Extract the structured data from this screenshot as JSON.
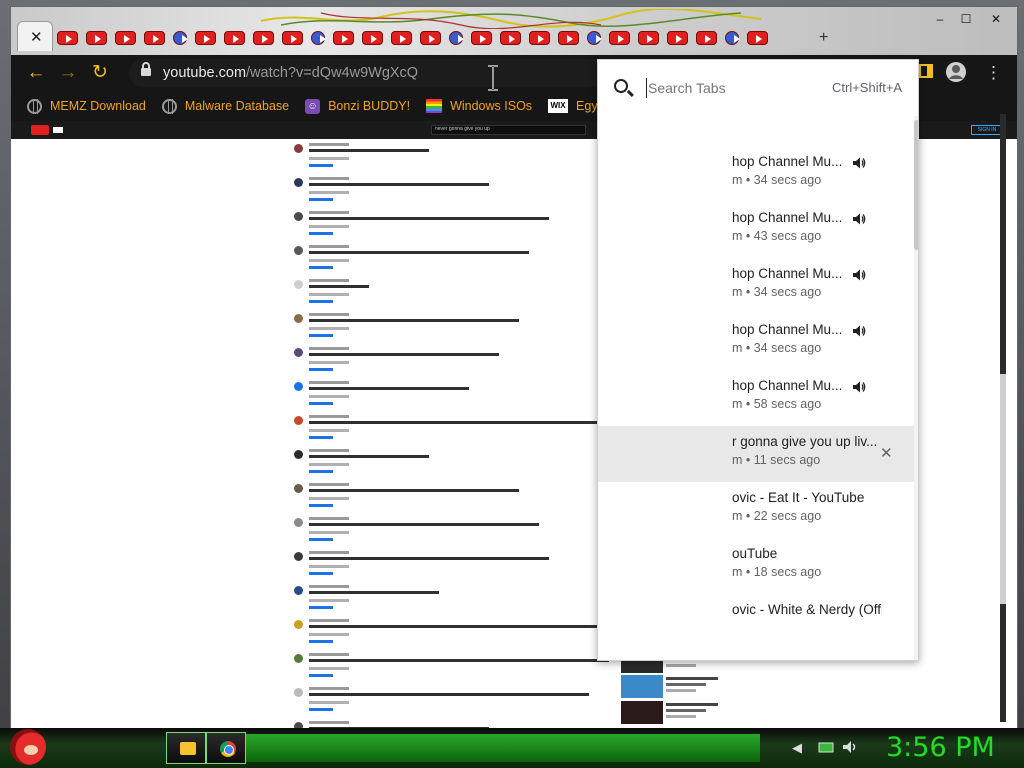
{
  "browser": {
    "url_host": "youtube.com",
    "url_path": "/watch?v=dQw4w9WgXcQ",
    "close_tab_glyph": "✕",
    "new_tab_glyph": "+",
    "window_minimize": "–",
    "window_maximize": "☐",
    "window_close": "✕"
  },
  "bookmarks": [
    {
      "label": "MEMZ Download",
      "icon": "globe-icon"
    },
    {
      "label": "Malware Database",
      "icon": "globe-icon"
    },
    {
      "label": "Bonzi BUDDY!",
      "icon": "bonzi-icon"
    },
    {
      "label": "Windows ISOs",
      "icon": "rainbow-flag-icon"
    },
    {
      "label": "Egypti",
      "icon": "wix-icon"
    }
  ],
  "search_tabs": {
    "placeholder": "Search Tabs",
    "shortcut": "Ctrl+Shift+A",
    "results": [
      {
        "title": "hop Channel Mu...",
        "subtitle": "m • 34 secs ago",
        "audio": true,
        "highlight": false
      },
      {
        "title": "hop Channel Mu...",
        "subtitle": "m • 43 secs ago",
        "audio": true,
        "highlight": false
      },
      {
        "title": "hop Channel Mu...",
        "subtitle": "m • 34 secs ago",
        "audio": true,
        "highlight": false
      },
      {
        "title": "hop Channel Mu...",
        "subtitle": "m • 34 secs ago",
        "audio": true,
        "highlight": false
      },
      {
        "title": "hop Channel Mu...",
        "subtitle": "m • 58 secs ago",
        "audio": true,
        "highlight": false
      },
      {
        "title": "r gonna give you up liv...",
        "subtitle": "m • 11 secs ago",
        "audio": false,
        "highlight": true
      },
      {
        "title": "ovic - Eat It - YouTube",
        "subtitle": "m • 22 secs ago",
        "audio": false,
        "highlight": false
      },
      {
        "title": "ouTube",
        "subtitle": "m • 18 secs ago",
        "audio": false,
        "highlight": false
      },
      {
        "title": "ovic - White & Nerdy (Offici",
        "subtitle": "",
        "audio": false,
        "highlight": false
      }
    ]
  },
  "youtube_page": {
    "search_text": "never gonna give you up",
    "sign_in": "SIGN IN"
  },
  "taskbar": {
    "clock": "3:56 PM"
  },
  "colors": {
    "bookmark_text": "#f0a520",
    "clock": "#22dd22",
    "youtube_red": "#e01f1f"
  }
}
